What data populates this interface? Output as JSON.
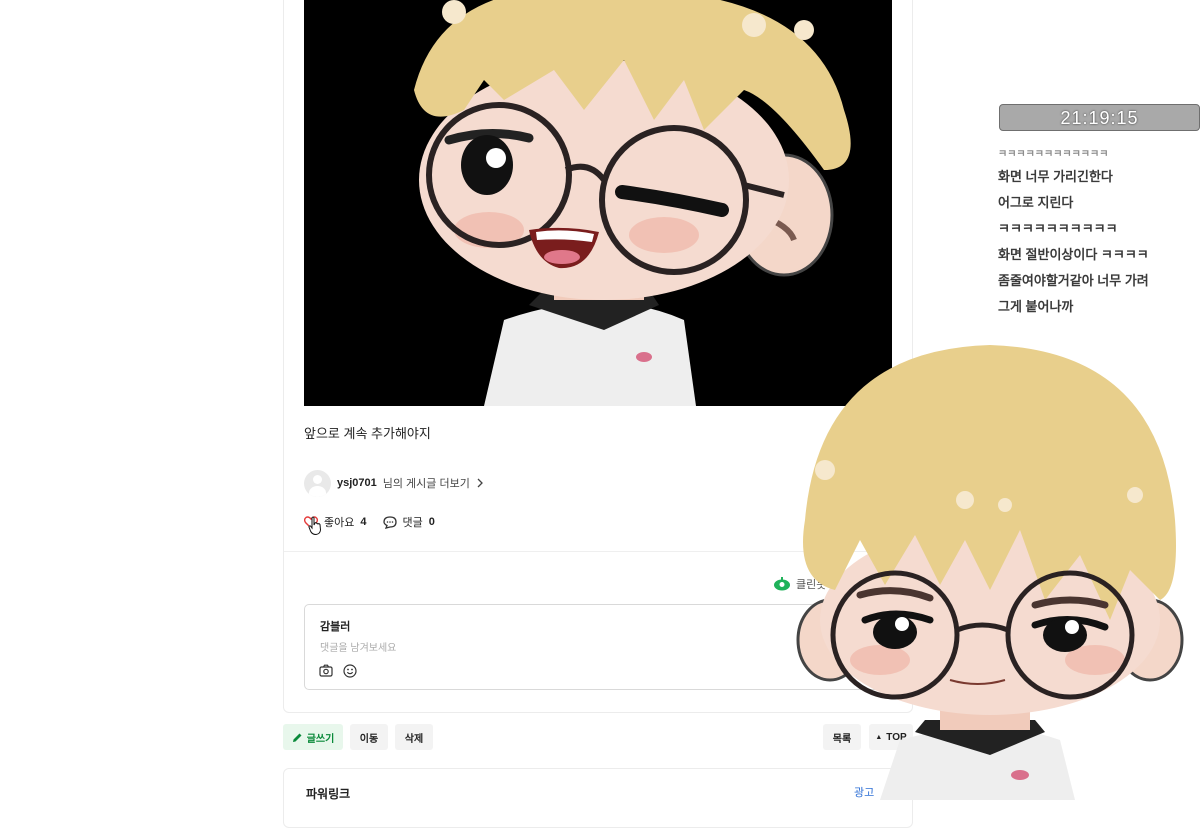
{
  "post": {
    "text": "앞으로 계속 추가해야지",
    "author": "ysj0701",
    "author_more": "님의 게시글 더보기",
    "like_label": "좋아요",
    "like_count": "4",
    "comment_label": "댓글",
    "comment_count": "0"
  },
  "clean_badge": "클린봇",
  "comment_box": {
    "user": "감블러",
    "placeholder": "댓글을 남겨보세요"
  },
  "buttons": {
    "write": "글쓰기",
    "move": "이동",
    "delete": "삭제",
    "list": "목록",
    "top": "TOP"
  },
  "bottom": {
    "title": "파워링크",
    "ad": "광고"
  },
  "overlay": {
    "clock": "21:19:15",
    "chat": [
      "ㅋㅋㅋㅋㅋㅋㅋㅋㅋㅋㅋㅋ",
      "화면 너무 가리긴한다",
      "어그로 지린다",
      "ㅋㅋㅋㅋㅋㅋㅋㅋㅋㅋ",
      "화면 절반이상이다 ㅋㅋㅋㅋ",
      "좀줄여야할거같아 너무 가려",
      "그게 붙어나까"
    ]
  },
  "colors": {
    "accent_green": "#0a8a3a",
    "clock_bg": "#a9a9a9",
    "hair": "#e8cf8c",
    "image_bg": "#000000"
  }
}
